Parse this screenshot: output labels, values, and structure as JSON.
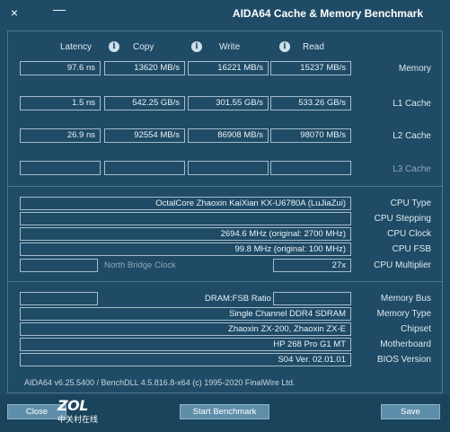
{
  "window": {
    "title": "AIDA64 Cache & Memory Benchmark",
    "close_label": "×",
    "minimize_label": "—"
  },
  "columns": {
    "read": "Read",
    "write": "Write",
    "copy": "Copy",
    "latency": "Latency",
    "info_glyph": "i"
  },
  "rows": {
    "memory": {
      "label": "Memory",
      "read": "15237 MB/s",
      "write": "16221 MB/s",
      "copy": "13620 MB/s",
      "latency": "97.6 ns"
    },
    "l1": {
      "label": "L1 Cache",
      "read": "533.26 GB/s",
      "write": "301.55 GB/s",
      "copy": "542.25 GB/s",
      "latency": "1.5 ns"
    },
    "l2": {
      "label": "L2 Cache",
      "read": "98070 MB/s",
      "write": "86908 MB/s",
      "copy": "92554 MB/s",
      "latency": "26.9 ns"
    },
    "l3": {
      "label": "L3 Cache",
      "read": "",
      "write": "",
      "copy": "",
      "latency": ""
    }
  },
  "cpu": {
    "type_label": "CPU Type",
    "type_value": "OctalCore Zhaoxin KaiXian KX-U6780A  (LuJiaZui)",
    "stepping_label": "CPU Stepping",
    "stepping_value": "",
    "clock_label": "CPU Clock",
    "clock_value": "2694.6 MHz  (original: 2700 MHz)",
    "fsb_label": "CPU FSB",
    "fsb_value": "99.8 MHz  (original: 100 MHz)",
    "multiplier_label": "CPU Multiplier",
    "multiplier_value": "27x",
    "nb_clock_label": "North Bridge Clock",
    "nb_clock_value": ""
  },
  "memory_info": {
    "bus_label": "Memory Bus",
    "bus_value": "",
    "ratio_label": "DRAM:FSB Ratio",
    "ratio_value": "",
    "type_label": "Memory Type",
    "type_value": "Single Channel DDR4 SDRAM",
    "chipset_label": "Chipset",
    "chipset_value": "Zhaoxin ZX-200, Zhaoxin ZX-E",
    "motherboard_label": "Motherboard",
    "motherboard_value": "HP 268 Pro G1 MT",
    "bios_label": "BIOS Version",
    "bios_value": "S04 Ver. 02.01.01"
  },
  "footer": {
    "version_text": "AIDA64 v6.25.5400 / BenchDLL 4.5.816.8-x64  (c) 1995-2020 FinalWire Ltd."
  },
  "buttons": {
    "save": "Save",
    "start": "Start Benchmark",
    "close": "Close"
  },
  "logo": {
    "main": "ZOL",
    "sub": "中关村在线"
  }
}
